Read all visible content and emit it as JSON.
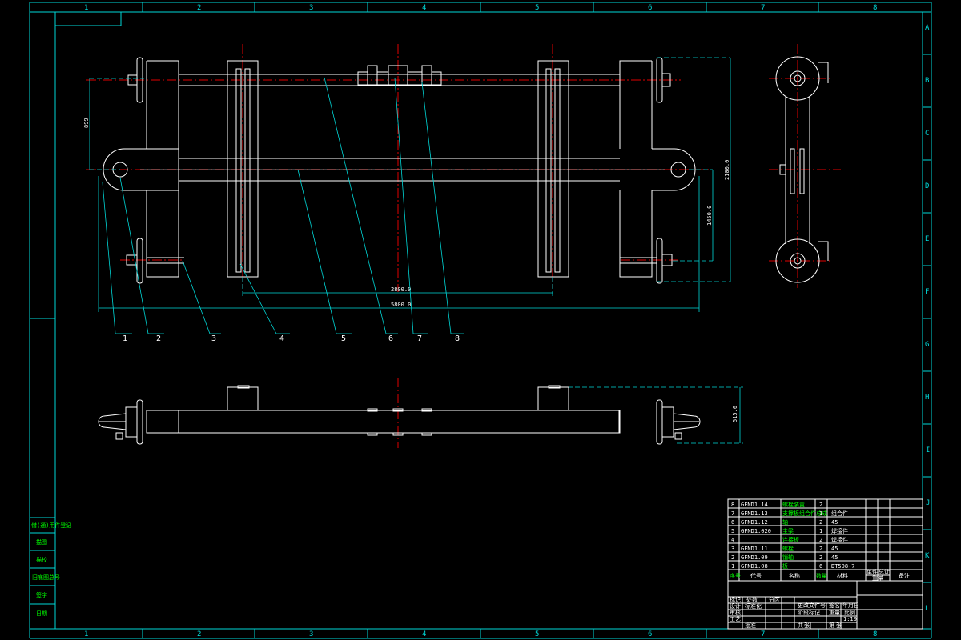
{
  "zones": {
    "columns": [
      "1",
      "2",
      "3",
      "4",
      "5",
      "6",
      "7",
      "8"
    ],
    "rows": [
      "A",
      "B",
      "C",
      "D",
      "E",
      "F",
      "G",
      "H",
      "I",
      "J",
      "K",
      "L"
    ]
  },
  "dimensions": {
    "d_899": "899",
    "d_2100": "2100.0",
    "d_1450": "1450.0",
    "d_2800": "2800.0",
    "d_5800": "5800.0",
    "d_515": "515.0"
  },
  "balloons": [
    "1",
    "2",
    "3",
    "4",
    "5",
    "6",
    "7",
    "8"
  ],
  "bom": {
    "rows": [
      {
        "no": "8",
        "code": "GFND1.14",
        "name": "螺栓装置",
        "qty": "2",
        "material": "",
        "weight": "",
        "note": ""
      },
      {
        "no": "7",
        "code": "GFND1.13",
        "name": "支撑板组合件总成",
        "qty": "1",
        "material": "组合件",
        "weight": "",
        "note": ""
      },
      {
        "no": "6",
        "code": "GFND1.12",
        "name": "轴",
        "qty": "2",
        "material": "45",
        "weight": "",
        "note": ""
      },
      {
        "no": "5",
        "code": "GFND1.020",
        "name": "主梁",
        "qty": "1",
        "material": "焊接件",
        "weight": "",
        "note": ""
      },
      {
        "no": "4",
        "code": "",
        "name": "连接板",
        "qty": "2",
        "material": "焊接件",
        "weight": "",
        "note": ""
      },
      {
        "no": "3",
        "code": "GFND1.11",
        "name": "螺栓",
        "qty": "2",
        "material": "45",
        "weight": "",
        "note": ""
      },
      {
        "no": "2",
        "code": "GFND1.09",
        "name": "销轴",
        "qty": "2",
        "material": "45",
        "weight": "",
        "note": ""
      },
      {
        "no": "1",
        "code": "GFND1.08",
        "name": "板",
        "qty": "6",
        "material": "DT508-7",
        "weight": "",
        "note": ""
      }
    ],
    "header": {
      "no": "序号",
      "code": "代号",
      "name": "名称",
      "qty": "数量",
      "material": "材料",
      "weight_single": "单件",
      "weight_total": "总计",
      "weight": "重量",
      "note": "备注"
    }
  },
  "left_strip": [
    "借(通)用件登记",
    "描图",
    "描校",
    "旧底图总号",
    "签字",
    "日期"
  ],
  "title_block": {
    "cells": [
      "标记",
      "处数",
      "分区",
      "更改文件号",
      "签名",
      "年月日",
      "设计",
      "标准化",
      "审核",
      "工艺",
      "批准",
      "阶段标记",
      "重量",
      "比例",
      "共",
      "张",
      "第",
      "张",
      "1:10"
    ]
  }
}
